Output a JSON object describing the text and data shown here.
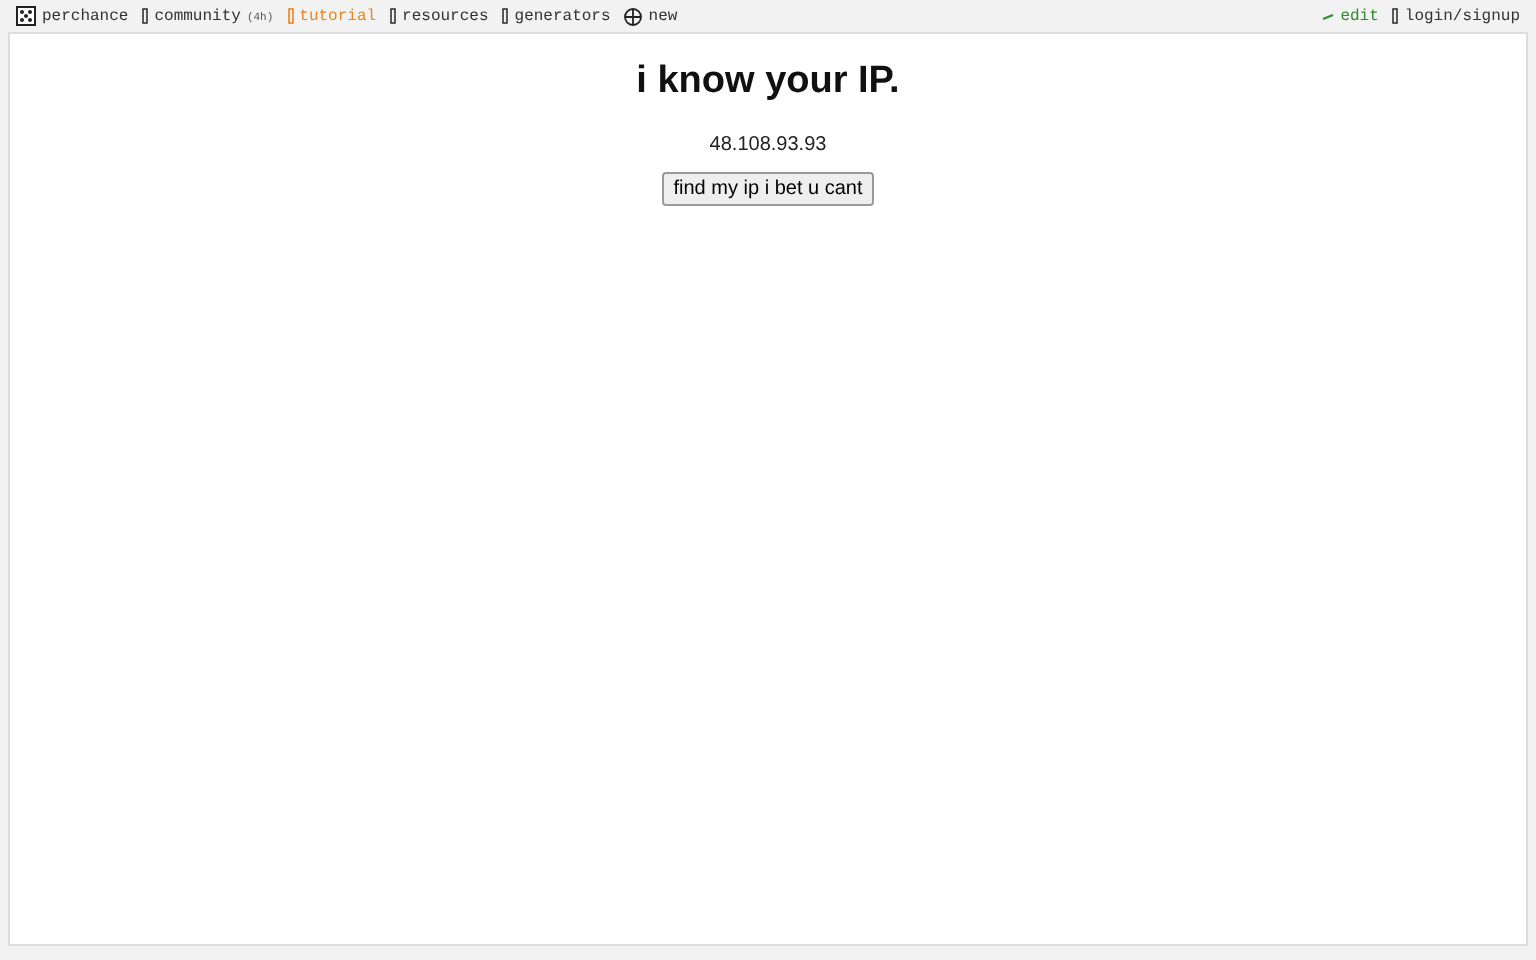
{
  "nav_left": [
    {
      "label": "perchance",
      "color": "#333333"
    },
    {
      "label": "community",
      "note": "(4h)",
      "color": "#333333"
    },
    {
      "label": "tutorial",
      "color": "#e8851f"
    },
    {
      "label": "resources",
      "color": "#333333"
    },
    {
      "label": "generators",
      "color": "#333333"
    },
    {
      "label": "new",
      "color": "#333333"
    }
  ],
  "nav_right": [
    {
      "label": "edit",
      "color": "#2e8b2e"
    },
    {
      "label": "login/signup",
      "color": "#333333"
    }
  ],
  "page": {
    "heading": "i know your IP.",
    "ip": "48.108.93.93",
    "button": "find my ip i bet u cant"
  }
}
